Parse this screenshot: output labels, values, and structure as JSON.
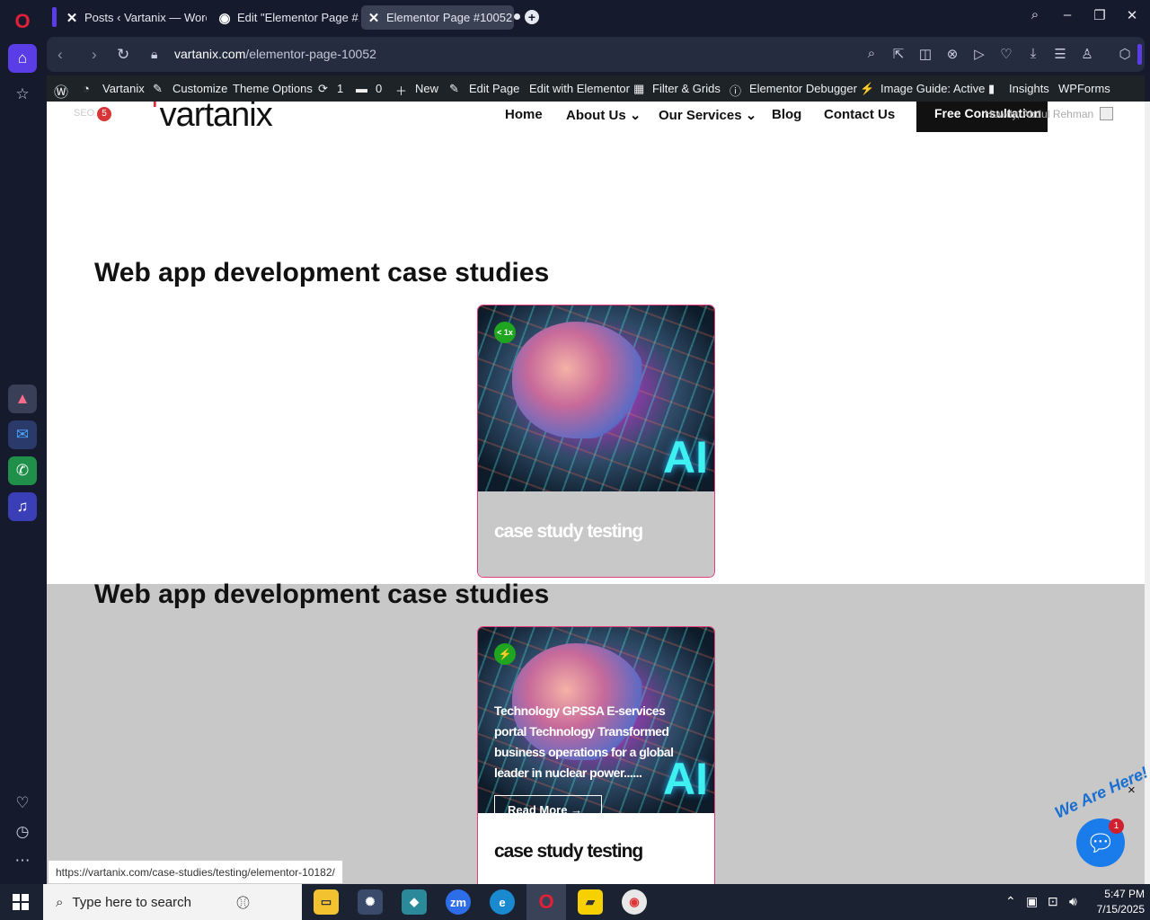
{
  "browser": {
    "tabs": [
      {
        "label": "Posts ‹ Vartanix — WordPre"
      },
      {
        "label": "Edit \"Elementor Page #100"
      },
      {
        "label": "Elementor Page #10052 -"
      }
    ],
    "new_tab_label": "+",
    "url_host": "vartanix.com",
    "url_path": "/elementor-page-10052",
    "status_url": "https://vartanix.com/case-studies/testing/elementor-10182/"
  },
  "wp_admin_bar": {
    "site_name": "Vartanix",
    "customize": "Customize",
    "theme_options": "Theme Options",
    "updates_count": "1",
    "comments_count": "0",
    "new": "New",
    "edit_page": "Edit Page",
    "edit_elementor": "Edit with Elementor",
    "filter_grids": "Filter & Grids",
    "elementor_debugger": "Elementor Debugger",
    "image_guide": "Image Guide: Active",
    "insights": "Insights",
    "wpforms": "WPForms"
  },
  "site": {
    "seo_label": "SEO",
    "seo_count": "5",
    "logo_text": "vartanix",
    "menu": {
      "home": "Home",
      "about": "About Us",
      "services": "Our Services",
      "blog": "Blog",
      "contact": "Contact Us"
    },
    "cta": "Free Consultation",
    "howdy": "Howdy, Abdul Rehman",
    "sections": [
      {
        "heading": "Web app development case studies",
        "card": {
          "badge": "< 1x",
          "title": "case study testing"
        }
      },
      {
        "heading": "Web app development case studies",
        "card": {
          "badge": "⚡",
          "overlay_text": "Technology GPSSA E-services portal Technology Transformed business operations for a global leader in nuclear power......",
          "read_more": "Read More →",
          "title": "case study testing"
        }
      }
    ],
    "image_text": "AI"
  },
  "chat_widget": {
    "tagline": "We Are Here!",
    "unread": "1",
    "close": "×"
  },
  "taskbar": {
    "search_placeholder": "Type here to search",
    "time": "5:47 PM",
    "date": "7/15/2025"
  },
  "colors": {
    "accent": "#e52a3a",
    "card_border": "#e23a7a",
    "chat": "#1a7bea"
  }
}
